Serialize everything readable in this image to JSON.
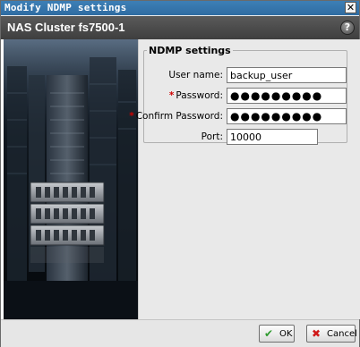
{
  "window": {
    "title": "Modify NDMP settings",
    "close_glyph": "✕"
  },
  "header": {
    "title": "NAS Cluster fs7500-1",
    "help_glyph": "?"
  },
  "ndmp_settings": {
    "legend": "NDMP settings",
    "fields": {
      "user_name": {
        "label": "User name:",
        "value": "backup_user",
        "required": false
      },
      "password": {
        "label": "Password:",
        "value": "●●●●●●●●●",
        "required": true
      },
      "confirm_password": {
        "label": "Confirm Password:",
        "value": "●●●●●●●●●",
        "required": true
      },
      "port": {
        "label": "Port:",
        "value": "10000",
        "required": false
      }
    },
    "required_marker": "*"
  },
  "footer": {
    "ok": {
      "label": "OK",
      "icon": "checkmark-icon",
      "glyph": "✔"
    },
    "cancel": {
      "label": "Cancel",
      "icon": "cross-icon",
      "glyph": "✖"
    }
  },
  "colors": {
    "title_bar": "#3470a8",
    "header_bar": "#4a4a4a",
    "required": "#d00000",
    "ok_icon": "#2f9a2f",
    "cancel_icon": "#d01818"
  }
}
